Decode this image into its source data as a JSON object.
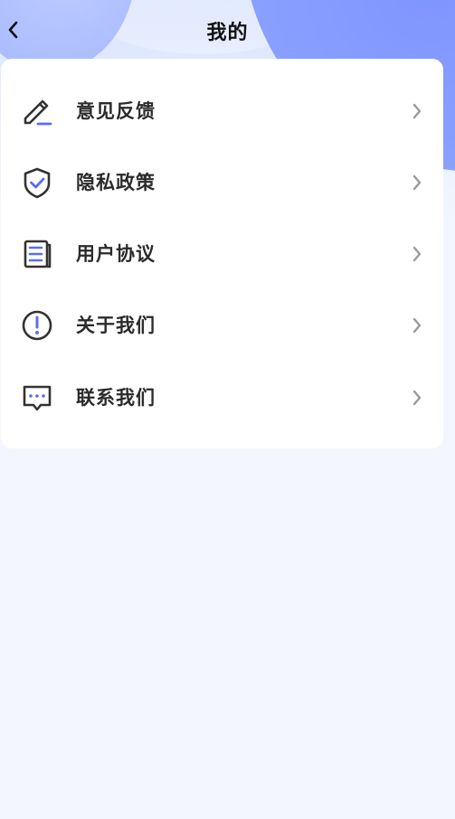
{
  "header": {
    "title": "我的",
    "back_icon": "chevron-left-icon"
  },
  "menu": {
    "items": [
      {
        "label": "意见反馈",
        "icon": "pencil-icon"
      },
      {
        "label": "隐私政策",
        "icon": "shield-check-icon"
      },
      {
        "label": "用户协议",
        "icon": "document-icon"
      },
      {
        "label": "关于我们",
        "icon": "info-circle-icon"
      },
      {
        "label": "联系我们",
        "icon": "chat-icon"
      }
    ],
    "chevron_icon": "chevron-right-icon"
  },
  "colors": {
    "accent": "#5b6df2",
    "icon_stroke": "#333333",
    "chevron": "#9a9a9a",
    "background": "#f3f7fd",
    "card": "#ffffff"
  }
}
